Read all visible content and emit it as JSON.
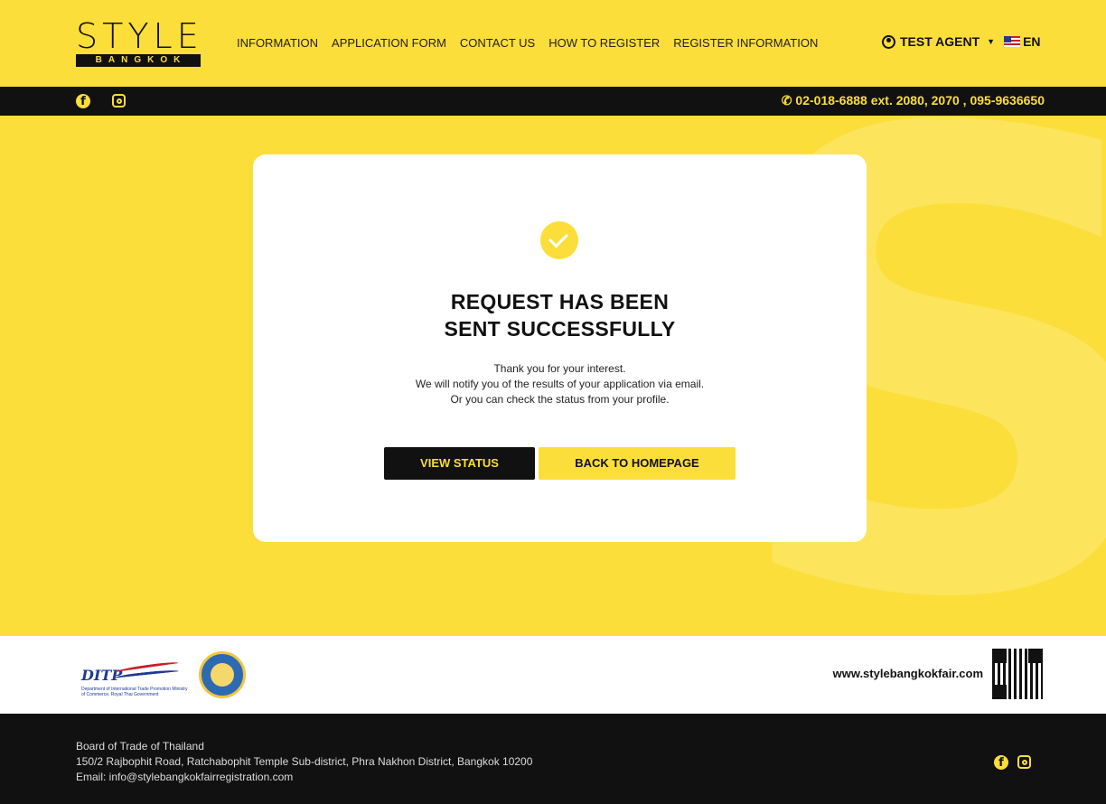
{
  "brand": {
    "logo_word": "STYLE",
    "logo_sub": "BANGKOK"
  },
  "nav": {
    "items": [
      {
        "label": "INFORMATION"
      },
      {
        "label": "APPLICATION FORM"
      },
      {
        "label": "CONTACT US"
      },
      {
        "label": "HOW TO REGISTER"
      },
      {
        "label": "REGISTER INFORMATION"
      }
    ],
    "user": "TEST AGENT",
    "language": "EN"
  },
  "infobar": {
    "phone": "02-018-6888 ext. 2080, 2070 , 095-9636650"
  },
  "card": {
    "title_line1": "REQUEST HAS BEEN",
    "title_line2": "SENT SUCCESSFULLY",
    "message_line1": "Thank you for your interest.",
    "message_line2": "We will notify you of the results of your application via email.",
    "message_line3": "Or you can check the status from your profile.",
    "view_status_label": "VIEW STATUS",
    "back_home_label": "BACK TO HOMEPAGE"
  },
  "footer": {
    "ditp_text": "DITP",
    "ditp_caption": "Department of International Trade Promotion Ministry of Commerce, Royal Thai Government",
    "website": "www.stylebangkokfair.com",
    "org": "Board of Trade of Thailand",
    "address": "150/2 Rajbophit Road, Ratchabophit Temple Sub-district, Phra Nakhon District, Bangkok 10200",
    "email": "Email: info@stylebangkokfairregistration.com"
  },
  "colors": {
    "accent": "#fcde3a",
    "dark": "#111111"
  },
  "icons": [
    "facebook-icon",
    "instagram-icon",
    "phone-icon",
    "user-circle-icon",
    "us-flag-icon",
    "check-circle-icon",
    "qr-code-icon"
  ]
}
